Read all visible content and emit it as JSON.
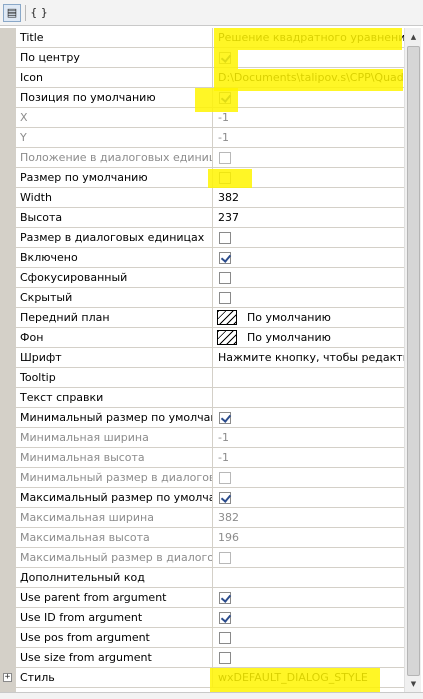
{
  "toolbar": {
    "btn1_icon": "list-view-icon",
    "btn1_glyph": "▤",
    "btn2_icon": "braces-icon",
    "btn2_glyph": "{ }"
  },
  "rows": [
    {
      "name": "Title",
      "kind": "text",
      "value": "Решение квадратного уравнения",
      "disabled": false
    },
    {
      "name": "По центру",
      "kind": "check",
      "checked": true,
      "disabled": false
    },
    {
      "name": "Icon",
      "kind": "text",
      "value": "D:\\Documents\\talipov.s\\CPP\\Quadratic",
      "disabled": false
    },
    {
      "name": "Позиция по умолчанию",
      "kind": "check",
      "checked": true,
      "disabled": false
    },
    {
      "name": "X",
      "kind": "text",
      "value": "-1",
      "disabled": true
    },
    {
      "name": "Y",
      "kind": "text",
      "value": "-1",
      "disabled": true
    },
    {
      "name": "Положение в диалоговых единицах",
      "kind": "check",
      "checked": false,
      "disabled": true
    },
    {
      "name": "Размер по умолчанию",
      "kind": "check",
      "checked": false,
      "disabled": false
    },
    {
      "name": "Width",
      "kind": "text",
      "value": "382",
      "disabled": false
    },
    {
      "name": "Высота",
      "kind": "text",
      "value": "237",
      "disabled": false
    },
    {
      "name": "Размер в диалоговых единицах",
      "kind": "check",
      "checked": false,
      "disabled": false
    },
    {
      "name": "Включено",
      "kind": "check",
      "checked": true,
      "disabled": false
    },
    {
      "name": "Сфокусированный",
      "kind": "check",
      "checked": false,
      "disabled": false
    },
    {
      "name": "Скрытый",
      "kind": "check",
      "checked": false,
      "disabled": false
    },
    {
      "name": "Передний план",
      "kind": "color",
      "value": "По умолчанию",
      "disabled": false
    },
    {
      "name": "Фон",
      "kind": "color",
      "value": "По умолчанию",
      "disabled": false
    },
    {
      "name": "Шрифт",
      "kind": "text",
      "value": "Нажмите кнопку, чтобы редактировать",
      "disabled": false
    },
    {
      "name": "Tooltip",
      "kind": "text",
      "value": "",
      "disabled": false
    },
    {
      "name": "Текст справки",
      "kind": "text",
      "value": "",
      "disabled": false
    },
    {
      "name": "Минимальный размер по умолчанию",
      "kind": "check",
      "checked": true,
      "disabled": false
    },
    {
      "name": "Минимальная ширина",
      "kind": "text",
      "value": "-1",
      "disabled": true
    },
    {
      "name": "Минимальная высота",
      "kind": "text",
      "value": "-1",
      "disabled": true
    },
    {
      "name": "Минимальный размер в диалоговых единицах",
      "kind": "check",
      "checked": false,
      "disabled": true
    },
    {
      "name": "Максимальный размер по умолчанию",
      "kind": "check",
      "checked": true,
      "disabled": false
    },
    {
      "name": "Максимальная ширина",
      "kind": "text",
      "value": "382",
      "disabled": true
    },
    {
      "name": "Максимальная высота",
      "kind": "text",
      "value": "196",
      "disabled": true
    },
    {
      "name": "Максимальный размер в диалоговых единицах",
      "kind": "check",
      "checked": false,
      "disabled": true
    },
    {
      "name": "Дополнительный код",
      "kind": "text",
      "value": "",
      "disabled": false
    },
    {
      "name": "Use parent from argument",
      "kind": "check",
      "checked": true,
      "disabled": false
    },
    {
      "name": "Use ID from argument",
      "kind": "check",
      "checked": true,
      "disabled": false
    },
    {
      "name": "Use pos from argument",
      "kind": "check",
      "checked": false,
      "disabled": false
    },
    {
      "name": "Use size from argument",
      "kind": "check",
      "checked": false,
      "disabled": false
    },
    {
      "name": "Стиль",
      "kind": "text",
      "value": "wxDEFAULT_DIALOG_STYLE",
      "disabled": false,
      "expandable": true,
      "expander_glyph": "+"
    }
  ],
  "colors": {
    "highlight": "#fff400",
    "margin": "#d4d0c8",
    "check": "#2b4c8c",
    "disabled_text": "#8c8c8c"
  },
  "scrollbar": {
    "up_glyph": "▲",
    "down_glyph": "▼"
  }
}
